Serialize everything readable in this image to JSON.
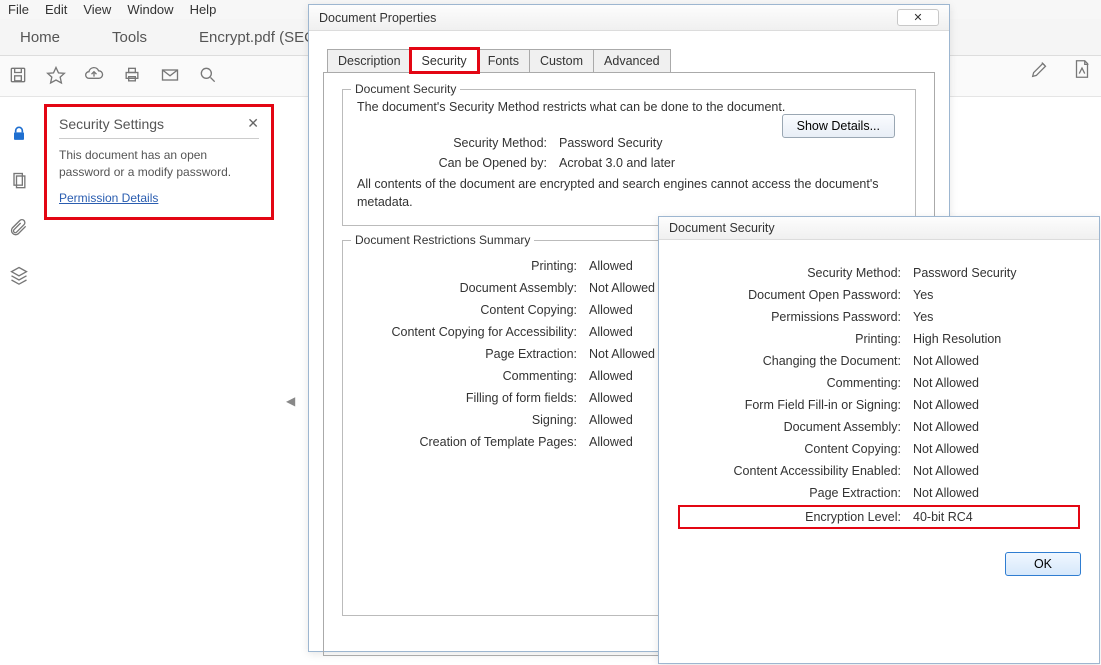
{
  "menubar": {
    "items": [
      "File",
      "Edit",
      "View",
      "Window",
      "Help"
    ]
  },
  "tabs": {
    "home": "Home",
    "tools": "Tools",
    "doc": "Encrypt.pdf (SECUR..."
  },
  "side_panel": {
    "title": "Security Settings",
    "text": "This document has an open password or a modify password.",
    "link": "Permission Details"
  },
  "docprops": {
    "title": "Document Properties",
    "tabs": [
      "Description",
      "Security",
      "Fonts",
      "Custom",
      "Advanced"
    ],
    "active_tab_index": 1,
    "fieldset1_title": "Document Security",
    "desc": "The document's Security Method restricts what can be done to the document.",
    "show_details": "Show Details...",
    "rows1": [
      {
        "lbl": "Security Method:",
        "val": "Password Security"
      },
      {
        "lbl": "Can be Opened by:",
        "val": "Acrobat 3.0 and later"
      }
    ],
    "meta_line": "All contents of the document are encrypted and search engines cannot access the document's metadata.",
    "fieldset2_title": "Document Restrictions Summary",
    "restrictions": [
      {
        "lbl": "Printing:",
        "val": "Allowed"
      },
      {
        "lbl": "Document Assembly:",
        "val": "Not Allowed"
      },
      {
        "lbl": "Content Copying:",
        "val": "Allowed"
      },
      {
        "lbl": "Content Copying for Accessibility:",
        "val": "Allowed"
      },
      {
        "lbl": "Page Extraction:",
        "val": "Not Allowed"
      },
      {
        "lbl": "Commenting:",
        "val": "Allowed"
      },
      {
        "lbl": "Filling of form fields:",
        "val": "Allowed"
      },
      {
        "lbl": "Signing:",
        "val": "Allowed"
      },
      {
        "lbl": "Creation of Template Pages:",
        "val": "Allowed"
      }
    ]
  },
  "docsec": {
    "title": "Document Security",
    "rows": [
      {
        "lbl": "Security Method:",
        "val": "Password Security"
      },
      {
        "lbl": "Document Open Password:",
        "val": "Yes"
      },
      {
        "lbl": "Permissions Password:",
        "val": "Yes"
      },
      {
        "lbl": "Printing:",
        "val": "High Resolution"
      },
      {
        "lbl": "Changing the Document:",
        "val": "Not Allowed"
      },
      {
        "lbl": "Commenting:",
        "val": "Not Allowed"
      },
      {
        "lbl": "Form Field Fill-in or Signing:",
        "val": "Not Allowed"
      },
      {
        "lbl": "Document Assembly:",
        "val": "Not Allowed"
      },
      {
        "lbl": "Content Copying:",
        "val": "Not Allowed"
      },
      {
        "lbl": "Content Accessibility Enabled:",
        "val": "Not Allowed"
      },
      {
        "lbl": "Page Extraction:",
        "val": "Not Allowed"
      },
      {
        "lbl": "Encryption Level:",
        "val": "40-bit RC4",
        "hl": true
      }
    ],
    "ok": "OK"
  }
}
